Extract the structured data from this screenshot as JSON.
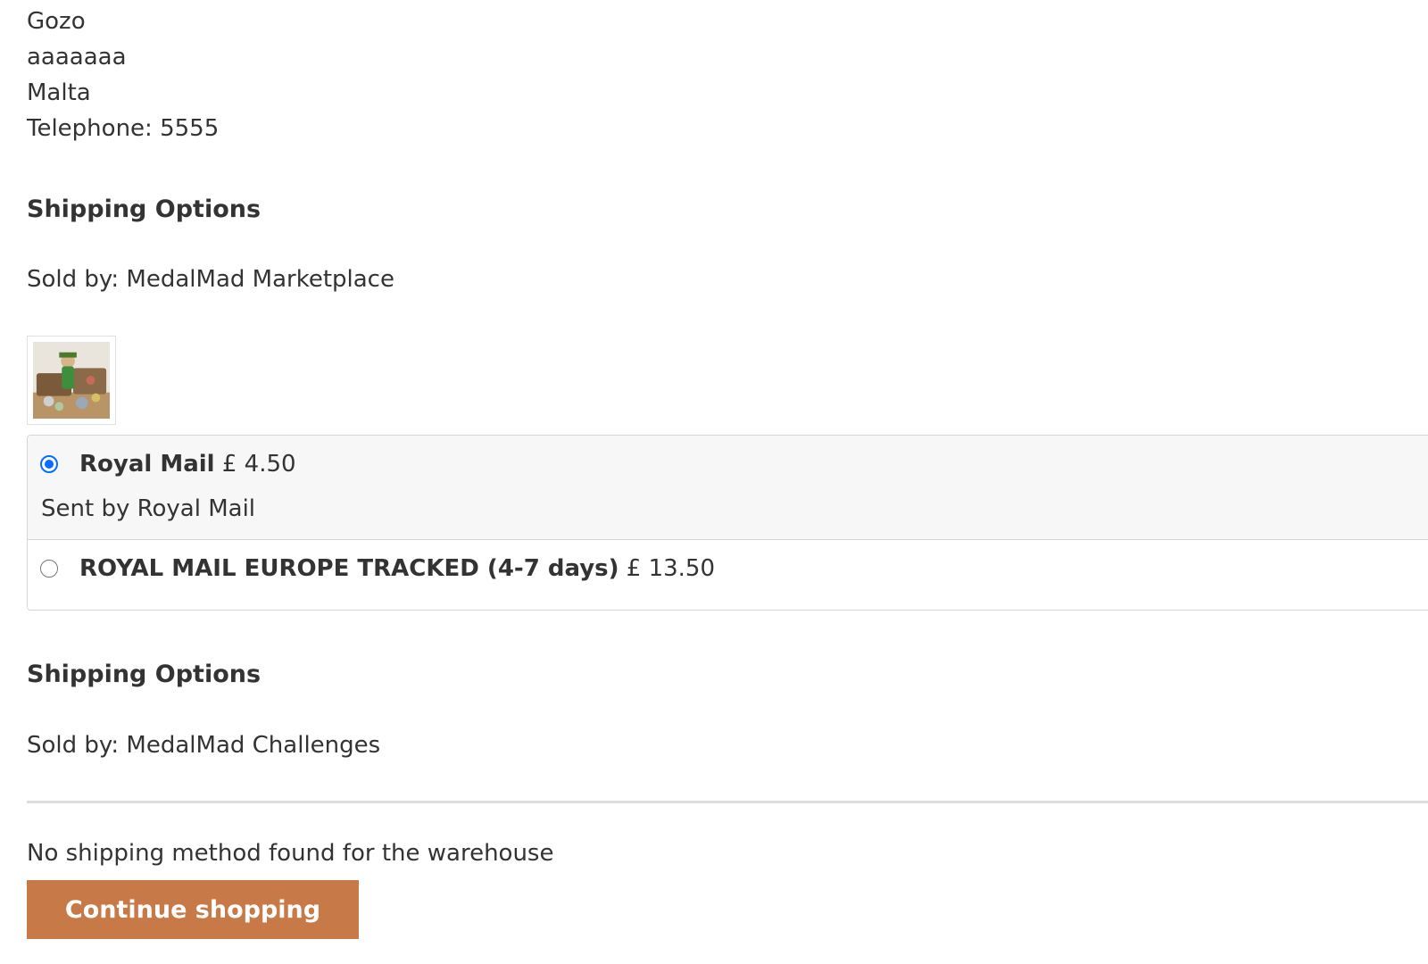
{
  "address": {
    "line1": "Gozo",
    "line2": "aaaaaaa",
    "line3": "Malta",
    "telephone": "Telephone: 5555"
  },
  "seller_1": {
    "section_title": "Shipping Options",
    "sold_by": "Sold by: MedalMad Marketplace",
    "options": [
      {
        "name": "Royal Mail",
        "price": "£ 4.50",
        "description": "Sent by Royal Mail",
        "selected": true
      },
      {
        "name": "ROYAL MAIL EUROPE TRACKED (4-7 days)",
        "price": "£ 13.50",
        "selected": false
      }
    ]
  },
  "seller_2": {
    "section_title": "Shipping Options",
    "sold_by": "Sold by: MedalMad Challenges",
    "message": "No shipping method found for the warehouse"
  },
  "actions": {
    "continue_label": "Continue shopping"
  },
  "colors": {
    "button_bg": "#c77a47",
    "radio_accent": "#0a6cff",
    "option_selected_bg": "#f7f7f7"
  }
}
